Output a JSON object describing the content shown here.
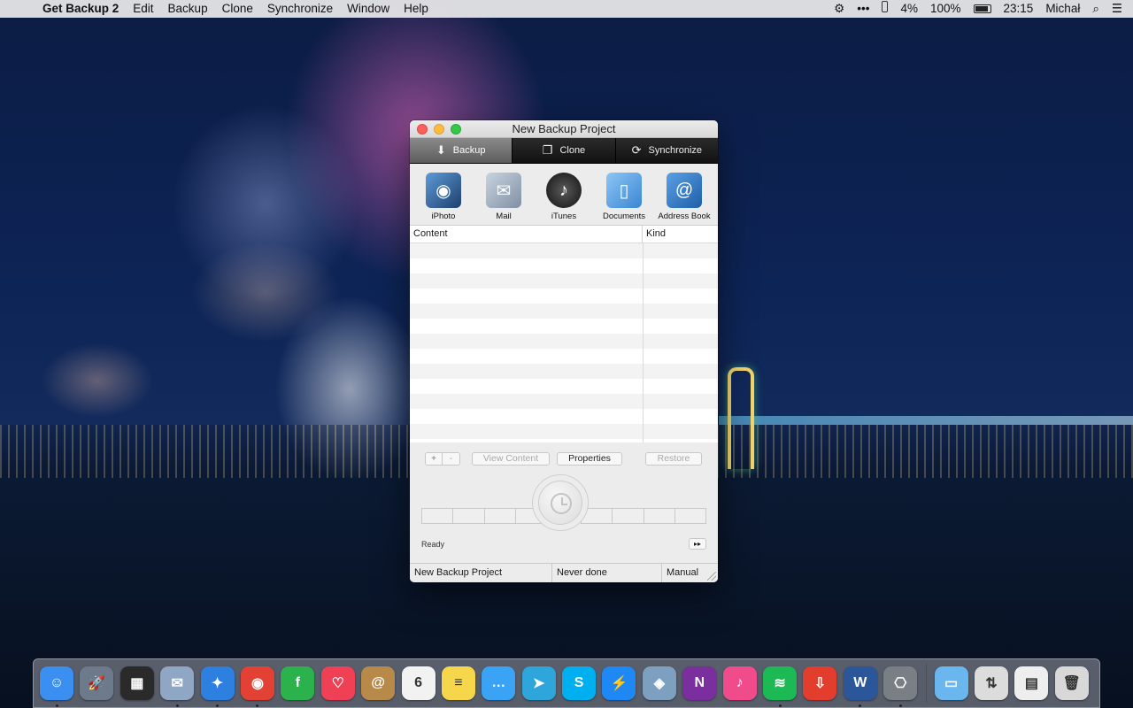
{
  "menubar": {
    "app_name": "Get Backup 2",
    "menus": [
      "Edit",
      "Backup",
      "Clone",
      "Synchronize",
      "Window",
      "Help"
    ],
    "battery_small_pct": "4%",
    "battery_pct": "100%",
    "time": "23:15",
    "user": "Michał",
    "icons": [
      "apple-icon",
      "gear-icon",
      "more-icon",
      "spotlight-icon",
      "notification-center-icon"
    ]
  },
  "window": {
    "title": "New Backup Project",
    "modes": [
      {
        "label": "Backup",
        "icon": "download-icon",
        "active": true
      },
      {
        "label": "Clone",
        "icon": "clone-icon",
        "active": false
      },
      {
        "label": "Synchronize",
        "icon": "sync-icon",
        "active": false
      }
    ],
    "sources": [
      {
        "label": "iPhoto",
        "icon": "camera-icon"
      },
      {
        "label": "Mail",
        "icon": "mail-stamp-icon"
      },
      {
        "label": "iTunes",
        "icon": "music-note-icon"
      },
      {
        "label": "Documents",
        "icon": "documents-folder-icon"
      },
      {
        "label": "Address Book",
        "icon": "address-book-icon"
      }
    ],
    "table": {
      "columns": [
        "Content",
        "Kind"
      ],
      "rows": []
    },
    "buttons": {
      "add": "+",
      "remove": "-",
      "view_content": "View Content",
      "properties": "Properties",
      "restore": "Restore",
      "fast_forward": "▸▸"
    },
    "status": "Ready",
    "footer": {
      "project_name": "New Backup Project",
      "last_backup": "Never done",
      "schedule": "Manual"
    }
  },
  "dock": {
    "apps": [
      {
        "name": "finder",
        "glyph": "☺",
        "color": "#3b8ff0",
        "running": true
      },
      {
        "name": "launchpad",
        "glyph": "🚀",
        "color": "#6c7a8c",
        "running": false
      },
      {
        "name": "mission-control",
        "glyph": "▦",
        "color": "#2a2a2a",
        "running": false
      },
      {
        "name": "mail",
        "glyph": "✉",
        "color": "#8fa7c4",
        "running": true
      },
      {
        "name": "safari",
        "glyph": "✦",
        "color": "#2d7fe0",
        "running": true
      },
      {
        "name": "chrome",
        "glyph": "◉",
        "color": "#e34133",
        "running": true
      },
      {
        "name": "feedly",
        "glyph": "f",
        "color": "#2bb24c",
        "running": false
      },
      {
        "name": "pocket",
        "glyph": "♡",
        "color": "#ef4056",
        "running": false
      },
      {
        "name": "contacts",
        "glyph": "@",
        "color": "#b88a4a",
        "running": false
      },
      {
        "name": "calendar",
        "glyph": "6",
        "color": "#f2f2f2",
        "running": false
      },
      {
        "name": "notes",
        "glyph": "≡",
        "color": "#f6d64a",
        "running": false
      },
      {
        "name": "messages",
        "glyph": "…",
        "color": "#3aa3f5",
        "running": false
      },
      {
        "name": "telegram",
        "glyph": "➤",
        "color": "#2ea6dc",
        "running": false
      },
      {
        "name": "skype",
        "glyph": "S",
        "color": "#00aff0",
        "running": false
      },
      {
        "name": "messenger",
        "glyph": "⚡",
        "color": "#1e88f5",
        "running": false
      },
      {
        "name": "preview",
        "glyph": "◈",
        "color": "#7ea0c0",
        "running": false
      },
      {
        "name": "onenote",
        "glyph": "N",
        "color": "#7b2f9e",
        "running": false
      },
      {
        "name": "itunes",
        "glyph": "♪",
        "color": "#f04c8c",
        "running": false
      },
      {
        "name": "spotify",
        "glyph": "≋",
        "color": "#1db954",
        "running": true
      },
      {
        "name": "pdf-app",
        "glyph": "⇩",
        "color": "#e23d2d",
        "running": false
      },
      {
        "name": "word",
        "glyph": "W",
        "color": "#2b579a",
        "running": true
      },
      {
        "name": "get-backup",
        "glyph": "⎔",
        "color": "#7a7f86",
        "running": true
      }
    ],
    "stacks": [
      {
        "name": "folder-stack",
        "glyph": "▭",
        "color": "#6ab7f0"
      },
      {
        "name": "elevator-stack",
        "glyph": "⇅",
        "color": "#dcdcdc"
      },
      {
        "name": "document-stack",
        "glyph": "▤",
        "color": "#eeeeee"
      },
      {
        "name": "trash",
        "glyph": "🗑",
        "color": "#d8d8d8"
      }
    ]
  }
}
